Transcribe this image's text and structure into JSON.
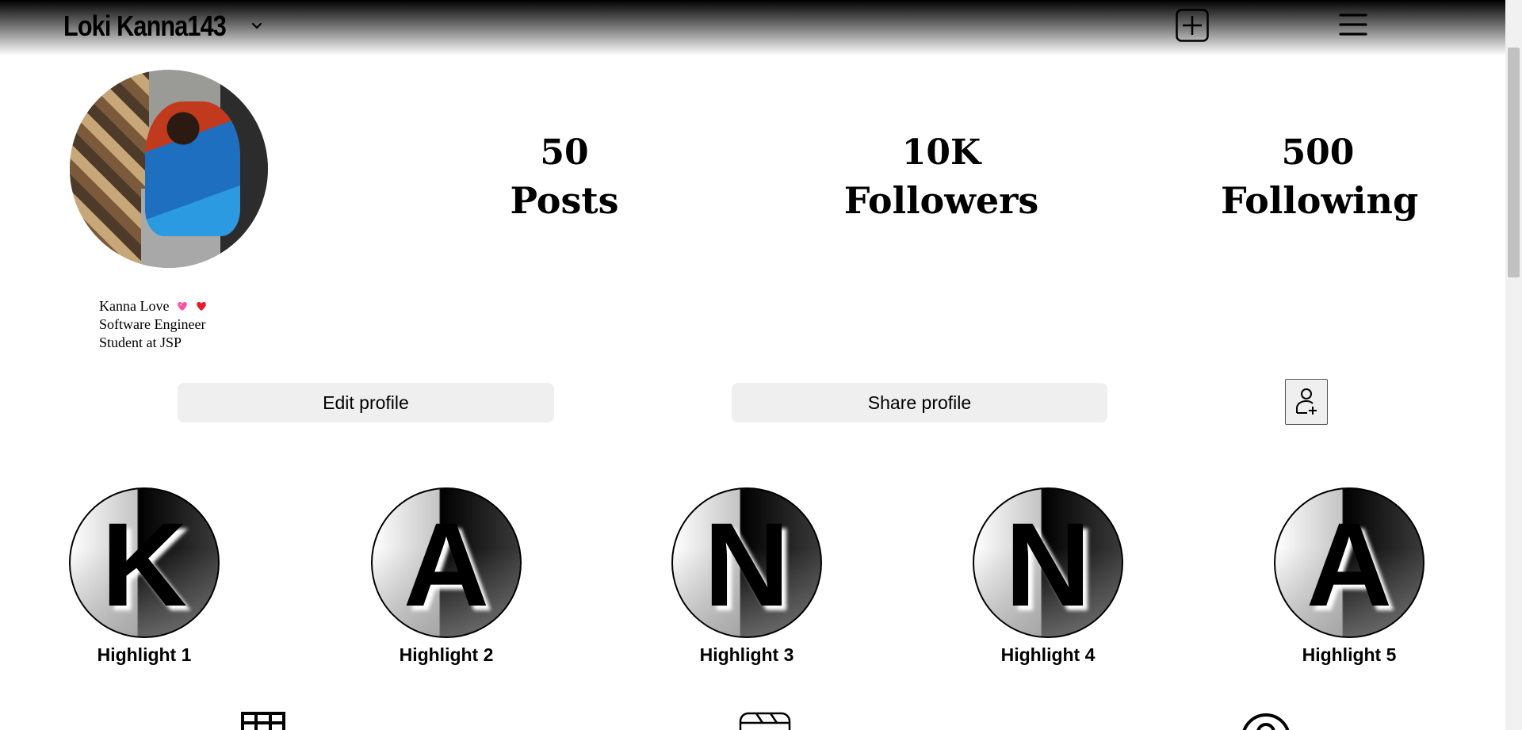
{
  "header": {
    "username": "Loki Kanna143",
    "icons": {
      "dropdown": "chevron-down-icon",
      "add_post": "plus-square-icon",
      "menu": "hamburger-menu-icon"
    }
  },
  "profile": {
    "avatar": "profile-photo",
    "stats": {
      "posts": {
        "value": "50",
        "label": "Posts"
      },
      "followers": {
        "value": "10K",
        "label": "Followers"
      },
      "following": {
        "value": "500",
        "label": "Following"
      }
    },
    "bio": [
      "Kanna Love",
      "Software Engineer",
      "Student at JSP"
    ],
    "bio_emojis": [
      "pink-heart",
      "red-heart"
    ]
  },
  "actions": {
    "edit": "Edit profile",
    "share": "Share profile",
    "add_user_icon": "add-user-icon"
  },
  "highlights": [
    {
      "letter": "K",
      "label": "Highlight 1"
    },
    {
      "letter": "A",
      "label": "Highlight 2"
    },
    {
      "letter": "N",
      "label": "Highlight 3"
    },
    {
      "letter": "N",
      "label": "Highlight 4"
    },
    {
      "letter": "A",
      "label": "Highlight 5"
    }
  ],
  "tabs": [
    "grid-icon",
    "reels-icon",
    "tagged-icon"
  ],
  "colors": {
    "button_bg": "#efefef",
    "heart_pink": "#ff4fa0",
    "heart_red": "#e8192c"
  }
}
